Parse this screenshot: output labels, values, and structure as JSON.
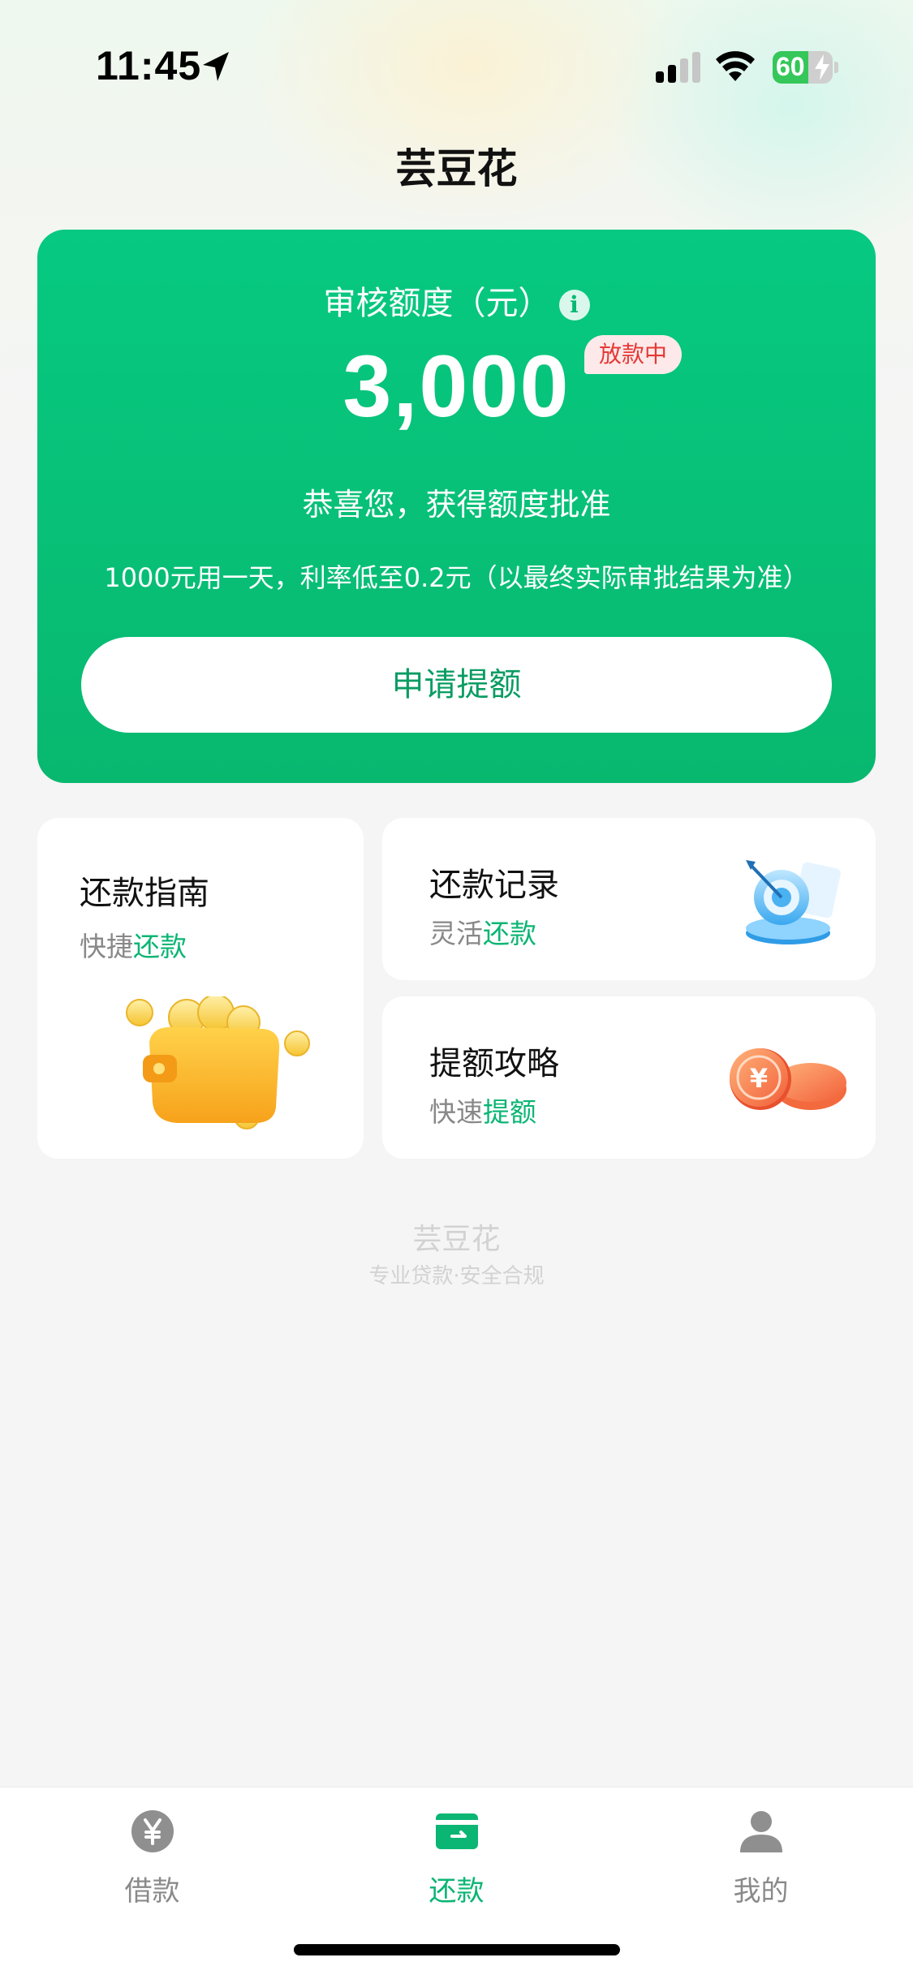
{
  "status_bar": {
    "time": "11:45",
    "battery_level": "60",
    "battery_fraction": 0.6
  },
  "header": {
    "title": "芸豆花"
  },
  "quota_card": {
    "label": "审核额度（元）",
    "amount": "3,000",
    "badge": "放款中",
    "message": "恭喜您，获得额度批准",
    "note": "1000元用一天，利率低至0.2元（以最终实际审批结果为准）",
    "button_label": "申请提额"
  },
  "cards": {
    "guide": {
      "title": "还款指南",
      "sub_prefix": "快捷",
      "sub_highlight": "还款"
    },
    "record": {
      "title": "还款记录",
      "sub_prefix": "灵活",
      "sub_highlight": "还款"
    },
    "strategy": {
      "title": "提额攻略",
      "sub_prefix": "快速",
      "sub_highlight": "提额"
    }
  },
  "footer": {
    "brand": "芸豆花",
    "slogan": "专业贷款·安全合规"
  },
  "tab_bar": {
    "tabs": [
      {
        "label": "借款",
        "icon": "yen-circle-icon",
        "active": false
      },
      {
        "label": "还款",
        "icon": "card-icon",
        "active": true
      },
      {
        "label": "我的",
        "icon": "person-icon",
        "active": false
      }
    ]
  },
  "colors": {
    "accent": "#07c981",
    "accent_dark": "#0bb574",
    "badge_red": "#e53935"
  }
}
